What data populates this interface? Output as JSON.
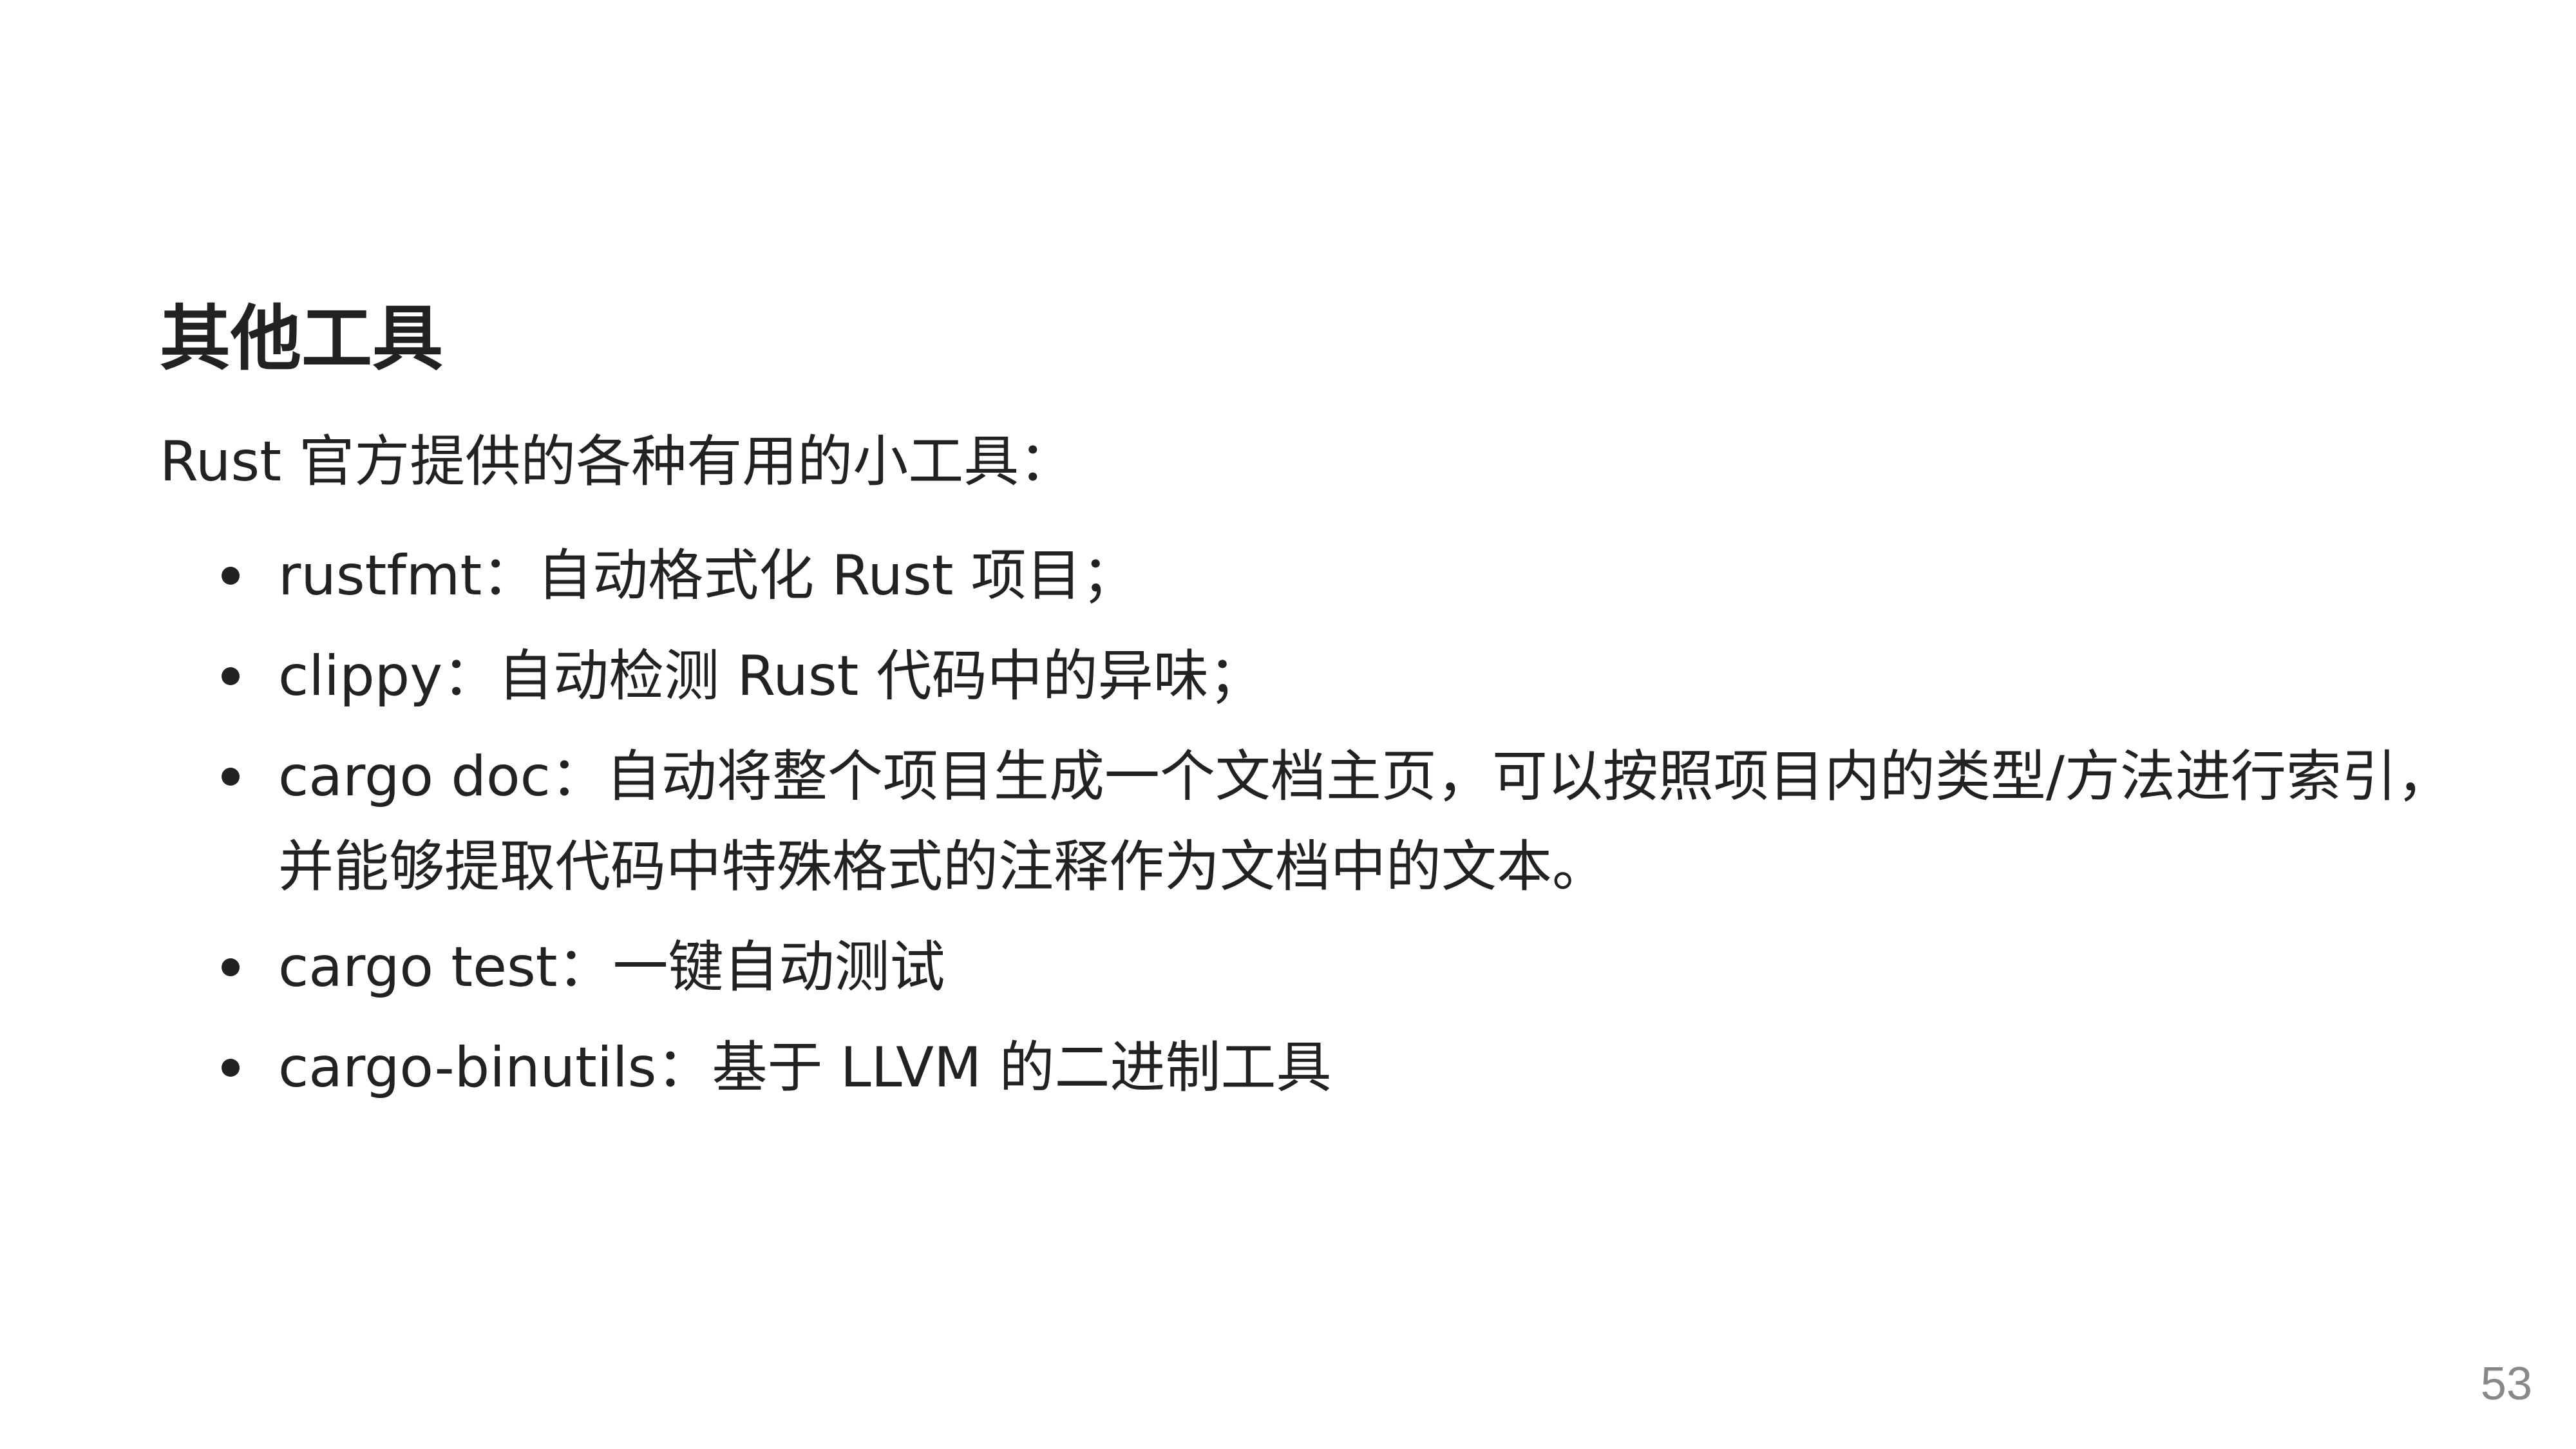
{
  "slide": {
    "title": "其他工具",
    "intro": "Rust 官方提供的各种有用的小工具：",
    "bullets": [
      "rustfmt：自动格式化 Rust 项目；",
      "clippy：自动检测 Rust 代码中的异味；",
      "cargo doc：自动将整个项目生成一个文档主页，可以按照项目内的类型/方法进行索引，并能够提取代码中特殊格式的注释作为文档中的文本。",
      "cargo test：一键自动测试",
      "cargo-binutils：基于 LLVM 的二进制工具"
    ],
    "page_number": "53"
  }
}
